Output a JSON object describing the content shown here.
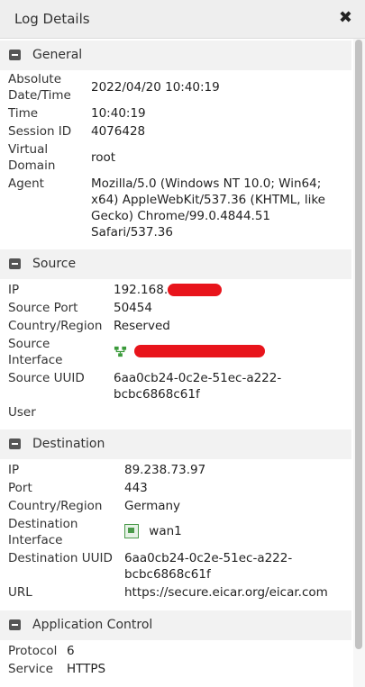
{
  "header": {
    "title": "Log Details",
    "close_label": "✖"
  },
  "general": {
    "title": "General",
    "rows": [
      {
        "label": "Absolute Date/Time",
        "value": "2022/04/20 10:40:19"
      },
      {
        "label": "Time",
        "value": "10:40:19"
      },
      {
        "label": "Session ID",
        "value": "4076428"
      },
      {
        "label": "Virtual Domain",
        "value": "root"
      },
      {
        "label": "Agent",
        "value": "Mozilla/5.0 (Windows NT 10.0; Win64; x64) AppleWebKit/537.36 (KHTML, like Gecko) Chrome/99.0.4844.51 Safari/537.36"
      }
    ]
  },
  "source": {
    "title": "Source",
    "ip_label": "IP",
    "ip_value": "192.168.",
    "port_label": "Source Port",
    "port_value": "50454",
    "country_label": "Country/Region",
    "country_value": "Reserved",
    "interface_label": "Source Interface",
    "uuid_label": "Source UUID",
    "uuid_value": "6aa0cb24-0c2e-51ec-a222-bcbc6868c61f",
    "user_label": "User"
  },
  "destination": {
    "title": "Destination",
    "ip_label": "IP",
    "ip_value": "89.238.73.97",
    "port_label": "Port",
    "port_value": "443",
    "country_label": "Country/Region",
    "country_value": "Germany",
    "interface_label": "Destination Interface",
    "interface_value": "wan1",
    "uuid_label": "Destination UUID",
    "uuid_value": "6aa0cb24-0c2e-51ec-a222-bcbc6868c61f",
    "url_label": "URL",
    "url_value": "https://secure.eicar.org/eicar.com"
  },
  "app_control": {
    "title": "Application Control",
    "protocol_label": "Protocol",
    "protocol_value": "6",
    "service_label": "Service",
    "service_value": "HTTPS"
  },
  "colors": {
    "redaction": "#e8141b",
    "section_bg": "#f2f2f2",
    "header_bg": "#eeeeee"
  },
  "icons": [
    "close-icon",
    "collapse-icon",
    "network-interface-icon",
    "port-icon"
  ]
}
